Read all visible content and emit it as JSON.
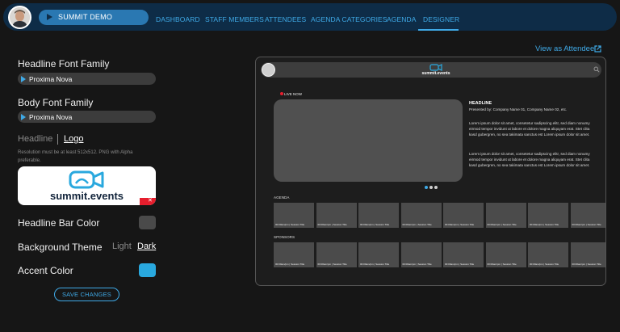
{
  "nav": {
    "event_name": "SUMMIT DEMO",
    "links": [
      "DASHBOARD",
      "STAFF MEMBERS",
      "ATTENDEES",
      "AGENDA CATEGORIES",
      "AGENDA",
      "DESIGNER"
    ],
    "active": "DESIGNER"
  },
  "form": {
    "headline_font_label": "Headline Font Family",
    "headline_font_value": "Proxima Nova",
    "body_font_label": "Body Font Family",
    "body_font_value": "Proxima Nova",
    "tab_headline": "Headline",
    "tab_logo": "Logo",
    "logo_hint": "Resolution must be at least 512x512. PNG with Alpha preferable.",
    "logo_wordmark": "summit.events",
    "headline_bar_color_label": "Headline Bar Color",
    "headline_bar_color": "#4a4a4a",
    "background_theme_label": "Background Theme",
    "theme_light": "Light",
    "theme_dark": "Dark",
    "theme_selected": "Dark",
    "accent_color_label": "Accent Color",
    "accent_color": "#29a8de",
    "save_label": "SAVE CHANGES"
  },
  "view_as_attendee": "View as Attendee",
  "preview": {
    "logo_wordmark": "summit.events",
    "live_label": "LIVE NOW",
    "headline": "HEADLINE",
    "presented_by": "Presented by: Company Name 01, Company Name 02, etc.",
    "paragraph_1": "Lorem ipsum dolor sit amet, consetetur sadipscing elitr, sed diam nonumy eirmod tempor invidunt ut labore et dolore magna aliquyam erat. Stet clita kasd gubergren, no sea takimata sanctus est Lorem ipsum dolor sit amet.",
    "paragraph_2": "Lorem ipsum dolor sit amet, consetetur sadipscing elitr, sed diam nonumy eirmod tempor invidunt ut labore et dolore magna aliquyam erat. Stet clita kasd gubergren, no sea takimata sanctus est Lorem ipsum dolor sit amet.",
    "agenda_label": "AGENDA",
    "sponsors_label": "SPONSORS",
    "card_caption": "00:00am/pm | Session Title",
    "card_count": 8,
    "carousel_colors": [
      "#3fa9e6",
      "#cfcfcf",
      "#cfcfcf"
    ]
  },
  "colors": {
    "nav_bg": "#0e2c47",
    "accent_link": "#3fa9e6",
    "page_bg": "#161616"
  }
}
